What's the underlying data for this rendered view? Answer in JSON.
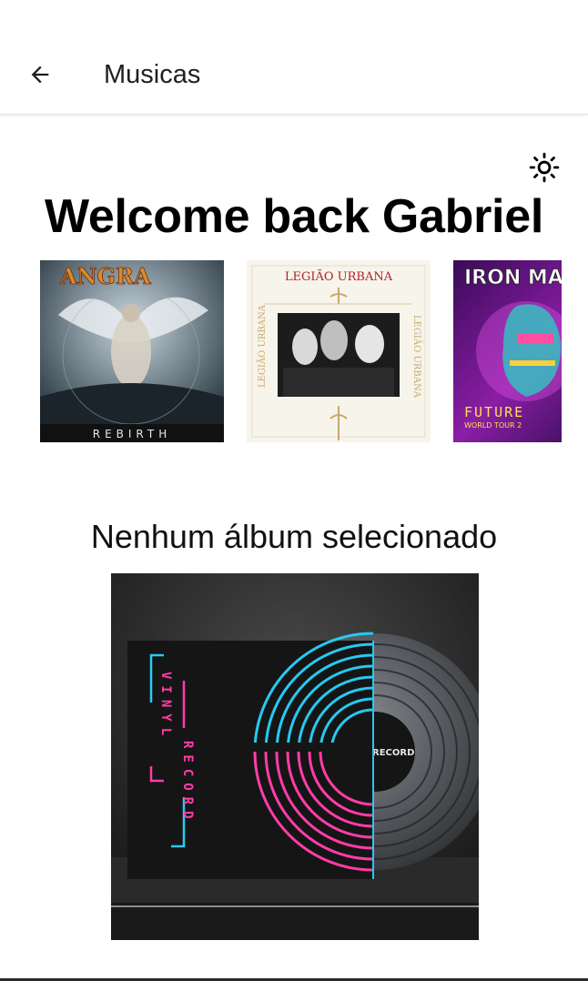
{
  "appbar": {
    "title": "Musicas",
    "back_icon": "arrow-left-icon"
  },
  "theme_toggle": {
    "icon": "sun-icon"
  },
  "welcome_text": "Welcome back Gabriel",
  "albums": [
    {
      "cover_text_top": "ANGRA",
      "cover_text_bottom": "REBIRTH"
    },
    {
      "cover_text_top": "LEGIÃO URBANA",
      "cover_text_side_left": "LEGIÃO URBANA",
      "cover_text_side_right": "LEGIÃO URBANA"
    },
    {
      "cover_text_top": "IRON MA",
      "cover_text_bottom": "FUTURE",
      "cover_text_small": "WORLD TOUR 2"
    }
  ],
  "empty_state": {
    "message": "Nenhum álbum selecionado",
    "placeholder_vinyl_left_text": "VINYL",
    "placeholder_vinyl_right_text": "RECORD",
    "placeholder_label_text": "RECORD"
  },
  "colors": {
    "accent_cyan": "#27c9f2",
    "accent_pink": "#ff3da8"
  }
}
